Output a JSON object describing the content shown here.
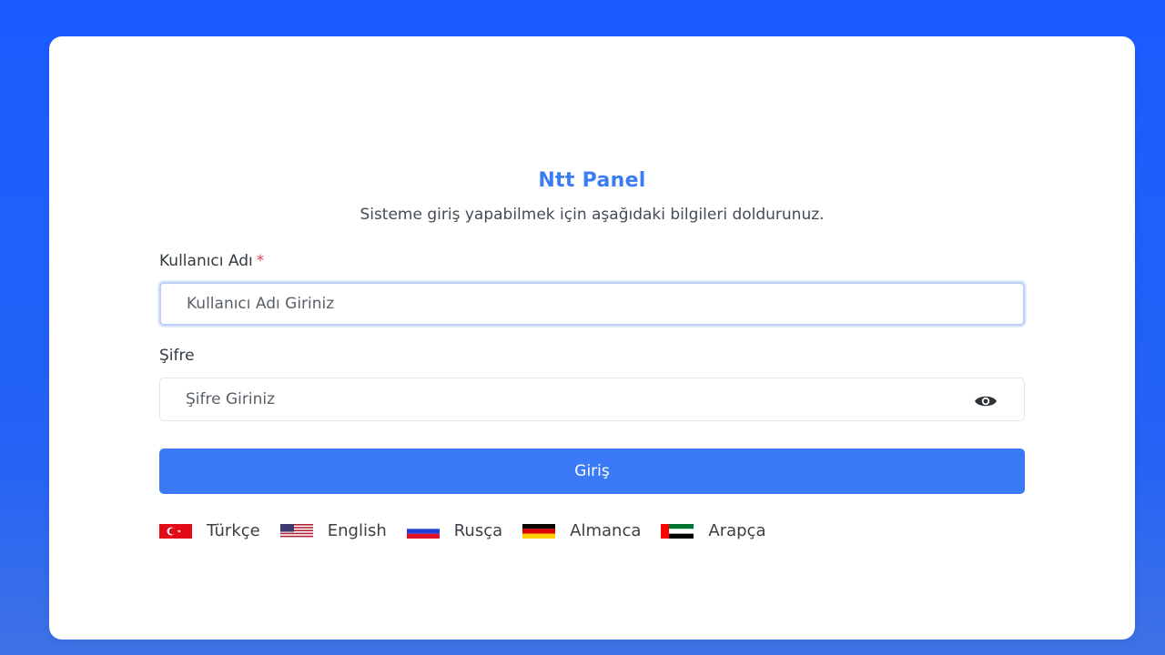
{
  "panel": {
    "title": "Ntt Panel",
    "subtitle": "Sisteme giriş yapabilmek için aşağıdaki bilgileri doldurunuz."
  },
  "form": {
    "username": {
      "label": "Kullanıcı Adı",
      "required_mark": "*",
      "placeholder": "Kullanıcı Adı Giriniz",
      "value": ""
    },
    "password": {
      "label": "Şifre",
      "placeholder": "Şifre Giriniz",
      "value": "",
      "toggle_icon": "eye-icon"
    },
    "submit_label": "Giriş"
  },
  "languages": [
    {
      "label": "Türkçe",
      "icon": "turkey-flag-icon"
    },
    {
      "label": "English",
      "icon": "usa-flag-icon"
    },
    {
      "label": "Rusça",
      "icon": "russia-flag-icon"
    },
    {
      "label": "Almanca",
      "icon": "germany-flag-icon"
    },
    {
      "label": "Arapça",
      "icon": "uae-flag-icon"
    }
  ],
  "colors": {
    "background": "#1a5cff",
    "accent": "#3a7af7",
    "title": "#3b7cf5",
    "required": "#e0434b"
  }
}
